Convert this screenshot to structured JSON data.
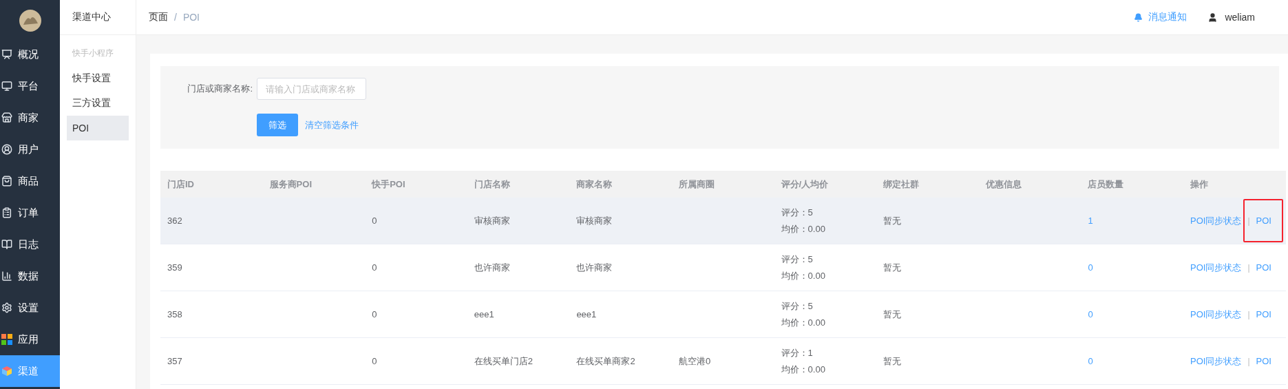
{
  "sidebar": {
    "items": [
      {
        "label": "概况",
        "selected": false
      },
      {
        "label": "平台",
        "selected": false
      },
      {
        "label": "商家",
        "selected": false
      },
      {
        "label": "用户",
        "selected": false
      },
      {
        "label": "商品",
        "selected": false
      },
      {
        "label": "订单",
        "selected": false
      },
      {
        "label": "日志",
        "selected": false
      },
      {
        "label": "数据",
        "selected": false
      },
      {
        "label": "设置",
        "selected": false
      },
      {
        "label": "应用",
        "selected": false
      },
      {
        "label": "渠道",
        "selected": true
      }
    ]
  },
  "subnav": {
    "title": "渠道中心",
    "group": "快手小程序",
    "items": [
      {
        "label": "快手设置",
        "selected": false
      },
      {
        "label": "三方设置",
        "selected": false
      },
      {
        "label": "POI",
        "selected": true
      }
    ]
  },
  "breadcrumb": [
    "页面",
    "/",
    "POI"
  ],
  "header": {
    "notification": "消息通知",
    "user": "weliam"
  },
  "filter": {
    "label": "门店或商家名称:",
    "placeholder": "请输入门店或商家名称",
    "submit": "筛选",
    "clear": "清空筛选条件"
  },
  "table": {
    "columns": [
      "门店ID",
      "服务商POI",
      "快手POI",
      "门店名称",
      "商家名称",
      "所属商圈",
      "评分/人均价",
      "绑定社群",
      "优惠信息",
      "店员数量",
      "操作"
    ],
    "rows": [
      {
        "selected": true,
        "id": "362",
        "provider_poi": "",
        "kuaishou_poi": "0",
        "store": "审核商家",
        "merchant": "审核商家",
        "area": "",
        "rating": "评分：5",
        "price": "均价：0.00",
        "group": "暂无",
        "promo": "",
        "staff": "1",
        "actions": [
          "POI同步状态",
          "|",
          "POI"
        ],
        "highlighted": true
      },
      {
        "selected": false,
        "id": "359",
        "provider_poi": "",
        "kuaishou_poi": "0",
        "store": "也许商家",
        "merchant": "也许商家",
        "area": "",
        "rating": "评分：5",
        "price": "均价：0.00",
        "group": "暂无",
        "promo": "",
        "staff": "0",
        "actions": [
          "POI同步状态",
          "|",
          "POI"
        ],
        "highlighted": false
      },
      {
        "selected": false,
        "id": "358",
        "provider_poi": "",
        "kuaishou_poi": "0",
        "store": "eee1",
        "merchant": "eee1",
        "area": "",
        "rating": "评分：5",
        "price": "均价：0.00",
        "group": "暂无",
        "promo": "",
        "staff": "0",
        "actions": [
          "POI同步状态",
          "|",
          "POI"
        ],
        "highlighted": false
      },
      {
        "selected": false,
        "id": "357",
        "provider_poi": "",
        "kuaishou_poi": "0",
        "store": "在线买单门店2",
        "merchant": "在线买单商家2",
        "area": "航空港0",
        "rating": "评分：1",
        "price": "均价：0.00",
        "group": "暂无",
        "promo": "",
        "staff": "0",
        "actions": [
          "POI同步状态",
          "|",
          "POI"
        ],
        "highlighted": false
      }
    ]
  }
}
